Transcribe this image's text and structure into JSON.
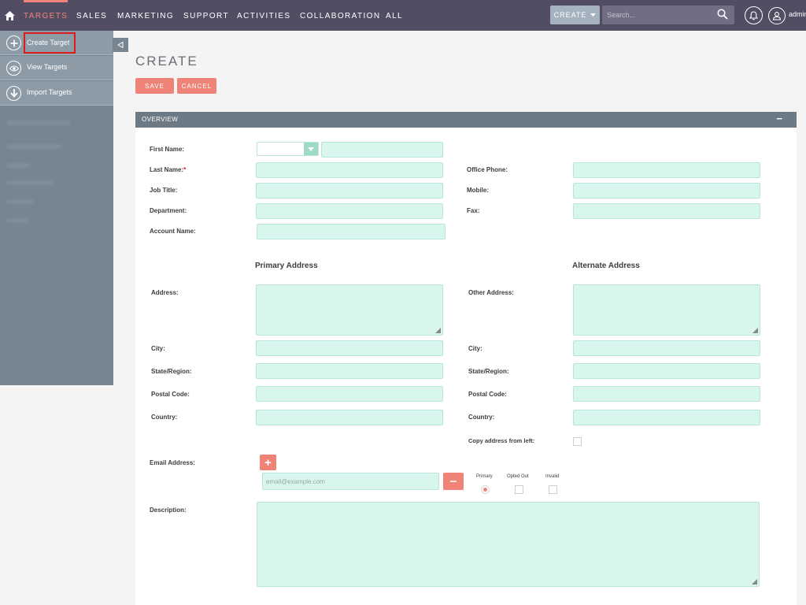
{
  "nav": {
    "items": [
      "TARGETS",
      "SALES",
      "MARKETING",
      "SUPPORT",
      "ACTIVITIES",
      "COLLABORATION",
      "ALL"
    ],
    "active": "TARGETS",
    "create_label": "CREATE",
    "search_placeholder": "Search...",
    "user_name": "admin"
  },
  "sidebar": {
    "items": [
      {
        "label": "Create Target",
        "icon": "plus-icon"
      },
      {
        "label": "View Targets",
        "icon": "eye-icon"
      },
      {
        "label": "Import Targets",
        "icon": "download-icon"
      }
    ]
  },
  "page": {
    "title": "CREATE",
    "save_label": "SAVE",
    "cancel_label": "CANCEL"
  },
  "panel": {
    "title": "OVERVIEW",
    "toggle": "−"
  },
  "form": {
    "first_name": "First Name:",
    "last_name": "Last Name:",
    "required_mark": "*",
    "job_title": "Job Title:",
    "department": "Department:",
    "account_name": "Account Name:",
    "office_phone": "Office Phone:",
    "mobile": "Mobile:",
    "fax": "Fax:",
    "primary_address": "Primary Address",
    "alternate_address": "Alternate Address",
    "address": "Address:",
    "other_address": "Other Address:",
    "city": "City:",
    "state": "State/Region:",
    "postal": "Postal Code:",
    "country": "Country:",
    "copy_address": "Copy address from left:",
    "email_address": "Email Address:",
    "email_placeholder": "email@example.com",
    "primary": "Primary",
    "opted_out": "Opted Out",
    "invalid": "Invalid",
    "description": "Description:"
  },
  "colors": {
    "nav_bg": "#534d64",
    "accent": "#f08377",
    "sidebar_bg": "#778591",
    "input_bg": "#d8f5ee",
    "panel_head": "#6c7a85"
  }
}
